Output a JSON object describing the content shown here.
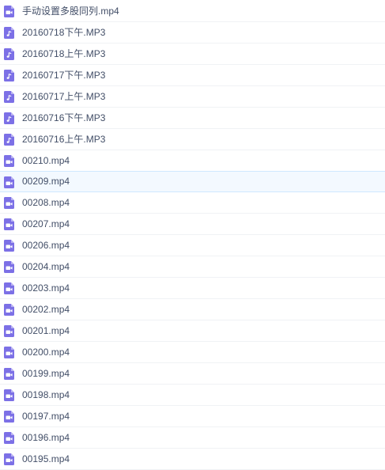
{
  "colors": {
    "icon_fill": "#7c70e6",
    "icon_fold": "#b8b1f2",
    "text": "#424e67",
    "row_border": "#f0f2f5",
    "selected_bg": "#f3f9ff",
    "selected_border": "#cfe8ff"
  },
  "files": [
    {
      "name": "手动设置多股同列.mp4",
      "icon": "video-file-icon"
    },
    {
      "name": "20160718下午.MP3",
      "icon": "audio-file-icon"
    },
    {
      "name": "20160718上午.MP3",
      "icon": "audio-file-icon"
    },
    {
      "name": "20160717下午.MP3",
      "icon": "audio-file-icon"
    },
    {
      "name": "20160717上午.MP3",
      "icon": "audio-file-icon"
    },
    {
      "name": "20160716下午.MP3",
      "icon": "audio-file-icon"
    },
    {
      "name": "20160716上午.MP3",
      "icon": "audio-file-icon"
    },
    {
      "name": "00210.mp4",
      "icon": "video-file-icon"
    },
    {
      "name": "00209.mp4",
      "icon": "video-file-icon",
      "selected": true
    },
    {
      "name": "00208.mp4",
      "icon": "video-file-icon"
    },
    {
      "name": "00207.mp4",
      "icon": "video-file-icon"
    },
    {
      "name": "00206.mp4",
      "icon": "video-file-icon"
    },
    {
      "name": "00204.mp4",
      "icon": "video-file-icon"
    },
    {
      "name": "00203.mp4",
      "icon": "video-file-icon"
    },
    {
      "name": "00202.mp4",
      "icon": "video-file-icon"
    },
    {
      "name": "00201.mp4",
      "icon": "video-file-icon"
    },
    {
      "name": "00200.mp4",
      "icon": "video-file-icon"
    },
    {
      "name": "00199.mp4",
      "icon": "video-file-icon"
    },
    {
      "name": "00198.mp4",
      "icon": "video-file-icon"
    },
    {
      "name": "00197.mp4",
      "icon": "video-file-icon"
    },
    {
      "name": "00196.mp4",
      "icon": "video-file-icon"
    },
    {
      "name": "00195.mp4",
      "icon": "video-file-icon"
    }
  ]
}
